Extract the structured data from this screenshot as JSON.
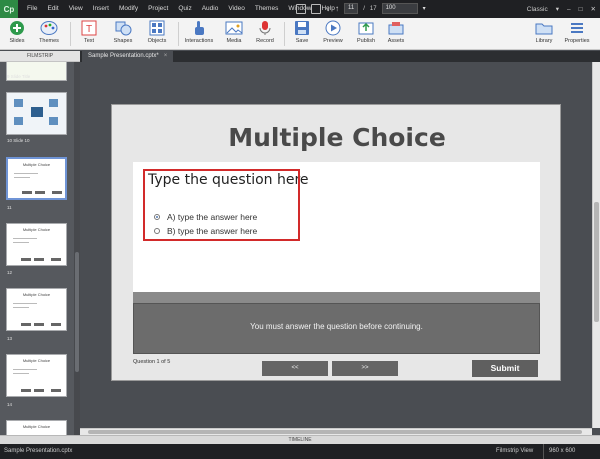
{
  "app": {
    "logo": "Cp",
    "menu": [
      "File",
      "Edit",
      "View",
      "Insert",
      "Modify",
      "Project",
      "Quiz",
      "Audio",
      "Video",
      "Themes",
      "Window",
      "Help"
    ],
    "slide_current": "11",
    "slide_sep": "/",
    "slide_total": "17",
    "zoom": "100",
    "workspace": "Classic"
  },
  "toolbar": {
    "slides": "Slides",
    "themes": "Themes",
    "text": "Text",
    "shapes": "Shapes",
    "objects": "Objects",
    "interactions": "Interactions",
    "media": "Media",
    "record": "Record",
    "save": "Save",
    "preview": "Preview",
    "publish": "Publish",
    "assets": "Assets",
    "library": "Library",
    "properties": "Properties"
  },
  "filmstrip": {
    "header": "FILMSTRIP",
    "labels": [
      "9 Slide Title",
      "10 Slide 10",
      "11",
      "12",
      "13",
      "14"
    ],
    "thumb_title": "Multiple Choice"
  },
  "tab": {
    "name": "Sample Presentation.cptx*",
    "close": "×"
  },
  "slide": {
    "title": "Multiple Choice",
    "question": "Type the question here",
    "options": [
      "A) type the answer here",
      "B) type the answer here"
    ],
    "selected_option": 0,
    "feedback": "You must answer the question before continuing.",
    "question_count": "Question 1 of 5",
    "prev": "<<",
    "next": ">>",
    "submit": "Submit"
  },
  "timeline": "TIMELINE",
  "status": {
    "file": "Sample Presentation.cptx",
    "view": "Filmstrip View",
    "size": "960 x 600"
  },
  "colors": {
    "accent_red": "#d22a2a",
    "selected_thumb": "#6f94d6",
    "logo_green": "#2d8a44"
  }
}
